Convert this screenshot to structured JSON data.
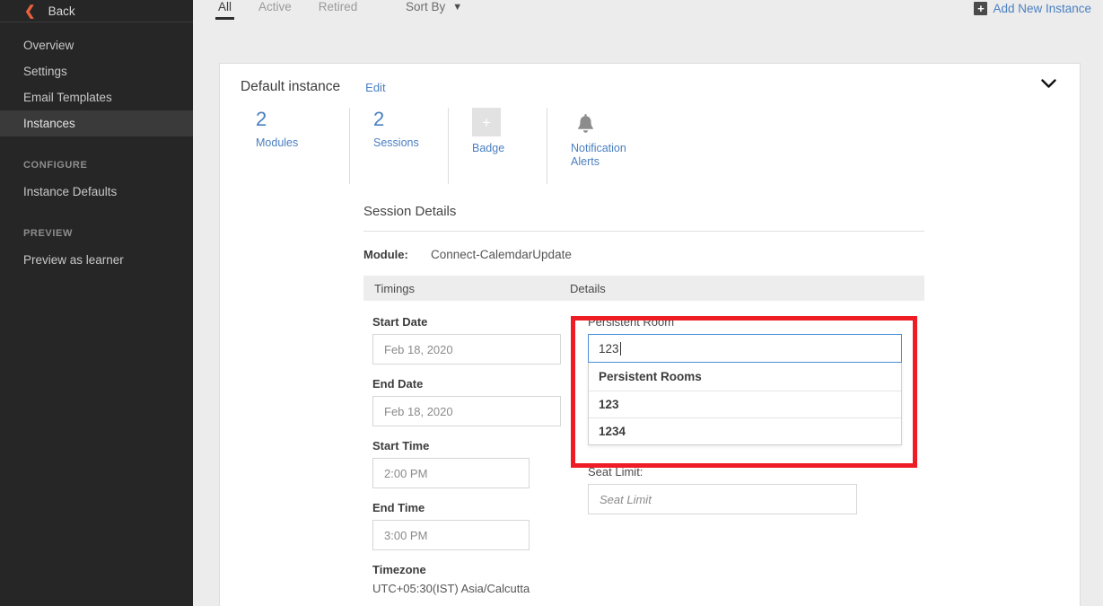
{
  "sidebar": {
    "back_label": "Back",
    "back_icon": "chevron-left-icon",
    "items": [
      {
        "label": "Overview",
        "active": false
      },
      {
        "label": "Settings",
        "active": false
      },
      {
        "label": "Email Templates",
        "active": false
      },
      {
        "label": "Instances",
        "active": true
      }
    ],
    "sections": [
      {
        "title": "CONFIGURE",
        "items": [
          {
            "label": "Instance Defaults"
          }
        ]
      },
      {
        "title": "PREVIEW",
        "items": [
          {
            "label": "Preview as learner"
          }
        ]
      }
    ]
  },
  "topbar": {
    "tabs": [
      {
        "label": "All",
        "active": true
      },
      {
        "label": "Active",
        "active": false
      },
      {
        "label": "Retired",
        "active": false
      }
    ],
    "sort_by_label": "Sort By",
    "sort_by_icon": "chevron-down-icon",
    "add_instance_label": "Add New Instance",
    "add_instance_icon": "plus-icon"
  },
  "card": {
    "title": "Default instance",
    "edit_label": "Edit",
    "collapse_icon": "chevron-down-icon",
    "stats": [
      {
        "value": "2",
        "label": "Modules",
        "kind": "number"
      },
      {
        "value": "2",
        "label": "Sessions",
        "kind": "number"
      },
      {
        "value": "+",
        "label": "Badge",
        "kind": "add-tile"
      },
      {
        "value": "",
        "label": "Notification Alerts",
        "kind": "bell"
      }
    ]
  },
  "session": {
    "title": "Session Details",
    "module_key": "Module:",
    "module_value": "Connect-CalemdarUpdate",
    "table_headers": {
      "timings": "Timings",
      "details": "Details"
    },
    "timings": [
      {
        "label": "Start Date",
        "value": "Feb 18, 2020",
        "width": "w210"
      },
      {
        "label": "End Date",
        "value": "Feb 18, 2020",
        "width": "w210"
      },
      {
        "label": "Start Time",
        "value": "2:00 PM",
        "width": "w175"
      },
      {
        "label": "End Time",
        "value": "3:00 PM",
        "width": "w175"
      }
    ],
    "timezone_label": "Timezone",
    "timezone_value": "UTC+05:30(IST) Asia/Calcutta",
    "persistent_room": {
      "label": "Persistent Room",
      "value": "123",
      "dropdown_group": "Persistent Rooms",
      "options": [
        "123",
        "1234"
      ]
    },
    "seat_limit": {
      "label": "Seat Limit:",
      "value": "",
      "placeholder": "Seat Limit"
    }
  },
  "colors": {
    "sidebar_bg": "#262626",
    "sidebar_active": "#3a3a3a",
    "accent_orange": "#e8613c",
    "link_blue": "#4a7fc1",
    "focus_blue": "#4a90d9",
    "annotation_red": "#ee1c24",
    "page_bg": "#ececec"
  }
}
